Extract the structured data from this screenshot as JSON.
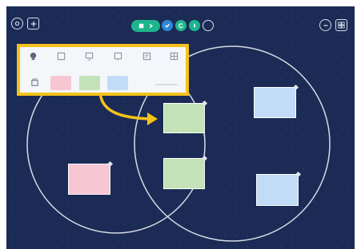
{
  "colors": {
    "board_background": "#1b2b55",
    "highlight": "#f4c21b",
    "note_green": "#c3e2b7",
    "note_pink": "#f7c6d3",
    "note_blue": "#c2dcf8",
    "pill": "#1fb58c",
    "dot_blue": "#2f86d6",
    "dot_green": "#1fb58c"
  },
  "top_bar": {
    "left_icons": [
      "settings-icon",
      "add-frame-icon"
    ],
    "center_icons": [
      "sticky-note-pill-icon",
      "check-circle-icon",
      "refresh-circle-icon",
      "timer-circle-icon",
      "hidden-circle-icon"
    ],
    "right_icons": [
      "chat-icon",
      "board-view-icon"
    ]
  },
  "toolbar_panel": {
    "tool_icons": [
      "shape-tool-icon",
      "note-tool-icon",
      "card-tool-icon",
      "chart-tool-icon",
      "text-tool-icon",
      "grid-tool-icon"
    ],
    "note_colors": [
      "#f7c6d3",
      "#c3e2b7",
      "#c2dcf8"
    ]
  },
  "canvas": {
    "diagram": "venn",
    "notes": [
      {
        "color": "green"
      },
      {
        "color": "blue"
      },
      {
        "color": "pink"
      },
      {
        "color": "green"
      },
      {
        "color": "blue"
      }
    ]
  }
}
